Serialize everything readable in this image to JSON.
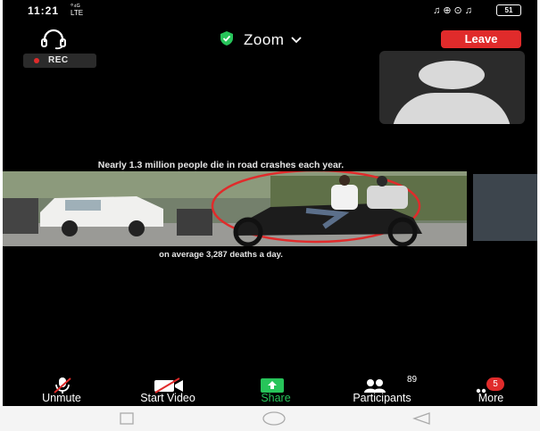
{
  "status_bar": {
    "time": "11:21",
    "network_top": "°⁴ᴳ",
    "network_bottom": "LTE",
    "icons": "♫⊕⊙♫",
    "battery": "51"
  },
  "header": {
    "title": "Zoom",
    "leave_label": "Leave",
    "rec_label": "REC"
  },
  "presentation": {
    "caption_top": "Nearly 1.3 million people die in road crashes each year.",
    "caption_bottom": "on average 3,287 deaths a day."
  },
  "toolbar": {
    "unmute_label": "Unmute",
    "start_video_label": "Start Video",
    "share_label": "Share",
    "participants_label": "Participants",
    "participants_count": "89",
    "more_label": "More",
    "more_badge": "5"
  },
  "colors": {
    "leave": "#e02b2b",
    "share": "#27c45a",
    "badge": "#e02b2b"
  },
  "icons": [
    "headset-icon",
    "shield-check-icon",
    "chevron-down-icon",
    "microphone-off-icon",
    "video-off-icon",
    "share-arrow-icon",
    "participants-icon",
    "more-dots-icon",
    "recent-apps-icon",
    "home-icon",
    "back-icon"
  ]
}
